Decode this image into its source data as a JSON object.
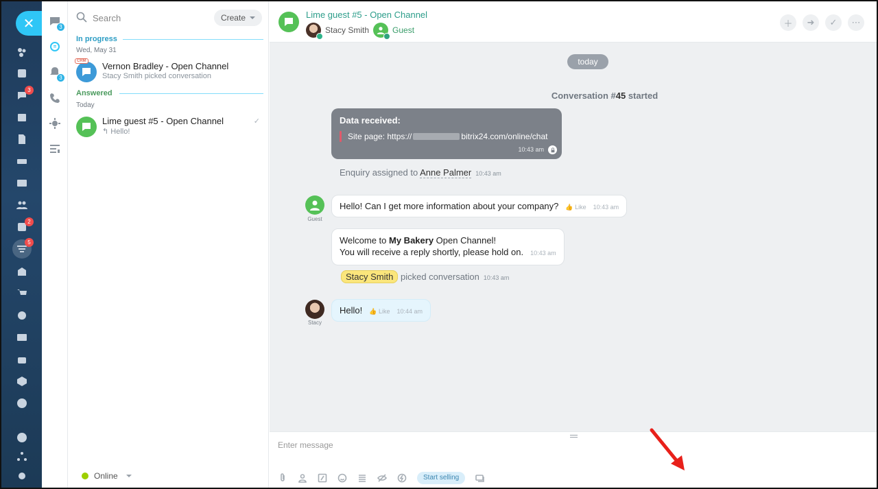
{
  "leftbar": {
    "badges": {
      "chats": "3",
      "tasks": "2",
      "filter": "5"
    }
  },
  "subbar": {
    "badges": {
      "recent": "3",
      "notifications": "3"
    }
  },
  "list": {
    "search_placeholder": "Search",
    "create_label": "Create",
    "in_progress": {
      "title": "In progress",
      "date": "Wed, May 31",
      "items": [
        {
          "title": "Vernon Bradley - Open Channel",
          "subtitle": "Stacy Smith picked conversation",
          "tag": "CRM",
          "avatar_color": "#3d9ad8"
        }
      ]
    },
    "answered": {
      "title": "Answered",
      "date": "Today",
      "items": [
        {
          "title": "Lime guest #5 - Open Channel",
          "subtitle": "Hello!",
          "avatar_color": "#55c157",
          "check": "✓"
        }
      ]
    },
    "status": "Online"
  },
  "chat": {
    "title": "Lime guest #5 - Open Channel",
    "members": [
      {
        "name": "Stacy Smith"
      },
      {
        "name": "Guest"
      }
    ],
    "date_pill": "today",
    "conversation_started_prefix": "Conversation #",
    "conversation_number": "45",
    "conversation_started_suffix": " started",
    "data_received": {
      "title": "Data received:",
      "site_label": "Site page: https://",
      "site_rest": "bitrix24.com/online/chat",
      "time": "10:43 am"
    },
    "enquiry": {
      "text": "Enquiry assigned to ",
      "name": "Anne Palmer",
      "time": "10:43 am"
    },
    "messages": [
      {
        "author": "Guest",
        "text": "Hello! Can I get more information about your company?",
        "like": "Like",
        "time": "10:43 am"
      },
      {
        "line1_pre": "Welcome to ",
        "line1_bold": "My Bakery",
        "line1_post": " Open Channel!",
        "line2": "You will receive a reply shortly, please hold on.",
        "time": "10:43 am"
      },
      {
        "author": "Stacy",
        "text": "Hello!",
        "like": "Like",
        "time": "10:44 am"
      }
    ],
    "picked": {
      "name": "Stacy Smith",
      "text": "picked conversation",
      "time": "10:43 am"
    },
    "composer": {
      "placeholder": "Enter message",
      "start_selling": "Start selling"
    },
    "colors": {
      "accent": "#2fc6f6",
      "guest_green": "#55c157",
      "arrow_red": "#e8201a"
    }
  }
}
